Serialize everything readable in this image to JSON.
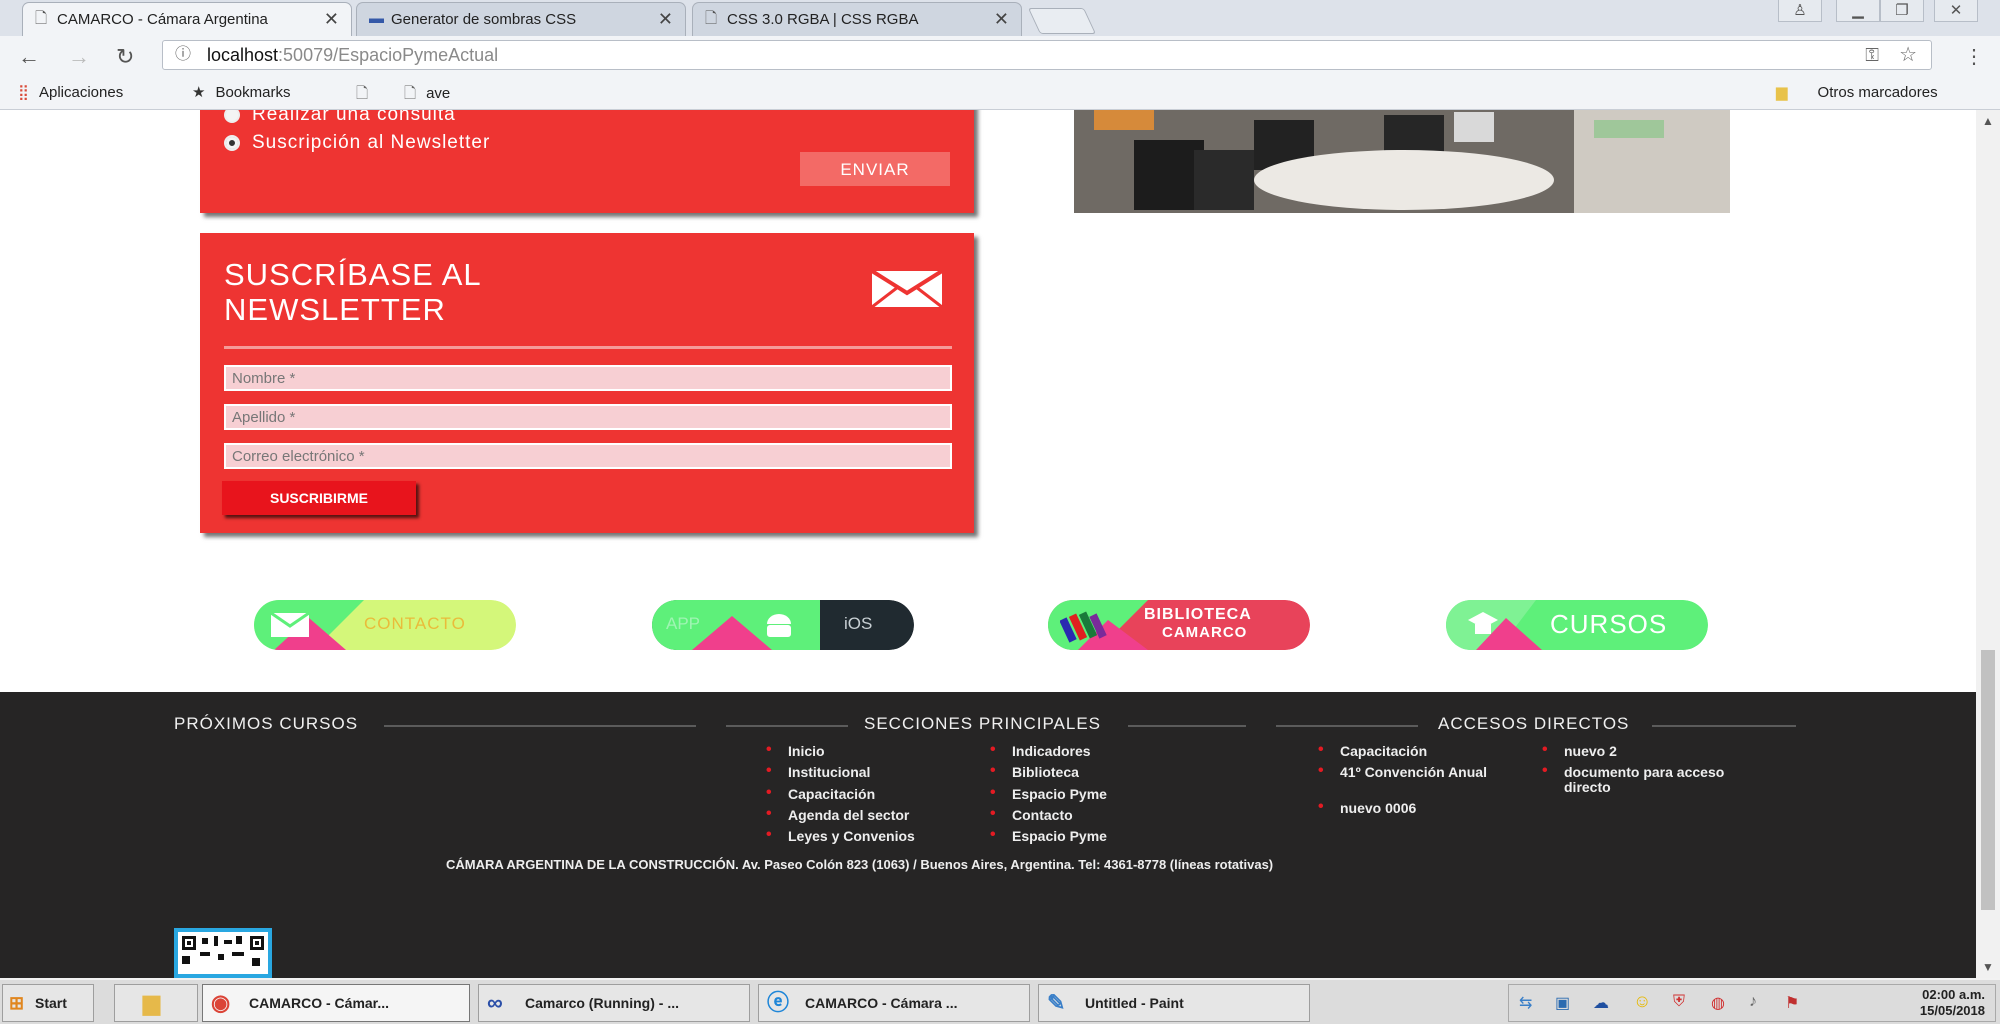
{
  "browser": {
    "tabs": [
      {
        "title": "CAMARCO - Cámara Argentina",
        "active": true
      },
      {
        "title": "Generator de sombras CSS",
        "active": false
      },
      {
        "title": "CSS 3.0 RGBA | CSS RGBA",
        "active": false
      }
    ],
    "address": {
      "host": "localhost",
      "path": ":50079/EspacioPymeActual"
    },
    "bookmarks": [
      "Aplicaciones",
      "Bookmarks",
      "",
      "ave"
    ],
    "other_bookmarks": "Otros marcadores"
  },
  "contact_form": {
    "options": [
      "Realizar una consulta",
      "Suscripción al Newsletter"
    ],
    "selected_option": 1,
    "send_label": "ENVIAR"
  },
  "newsletter": {
    "title_line1": "SUSCRÍBASE AL",
    "title_line2": "NEWSLETTER",
    "placeholders": {
      "nombre": "Nombre *",
      "apellido": "Apellido *",
      "email": "Correo electrónico *"
    },
    "submit_label": "SUSCRIBIRME"
  },
  "quick_buttons": {
    "contacto": "CONTACTO",
    "app": "APP",
    "ios": "iOS",
    "biblioteca_1": "BIBLIOTECA",
    "biblioteca_2": "CAMARCO",
    "cursos": "CURSOS"
  },
  "footer": {
    "proximos_cursos": "PRÓXIMOS CURSOS",
    "secciones_principales": "SECCIONES PRINCIPALES",
    "accesos_directos": "ACCESOS DIRECTOS",
    "secciones_col1": [
      "Inicio",
      "Institucional",
      "Capacitación",
      "Agenda del sector",
      "Leyes y Convenios"
    ],
    "secciones_col2": [
      "Indicadores",
      "Biblioteca",
      "Espacio Pyme",
      "Contacto",
      "Espacio Pyme"
    ],
    "accesos_col1": [
      "Capacitación",
      "41º Convención Anual",
      "nuevo 0006"
    ],
    "accesos_col2": [
      "nuevo 2",
      "documento para acceso directo"
    ],
    "address": "CÁMARA ARGENTINA DE LA CONSTRUCCIÓN. Av. Paseo Colón 823 (1063) / Buenos Aires, Argentina. Tel: 4361-8778 (líneas rotativas)"
  },
  "taskbar": {
    "start": "Start",
    "items": [
      "CAMARCO - Cámar...",
      "Camarco (Running) - ...",
      "CAMARCO - Cámara ...",
      "Untitled - Paint"
    ],
    "time": "02:00 a.m.",
    "date": "15/05/2018"
  },
  "colors": {
    "accent_red": "#ee3432",
    "footer_bg": "#262525",
    "pill_green": "#5ef07a",
    "pill_yellow": "#d4f77a"
  }
}
